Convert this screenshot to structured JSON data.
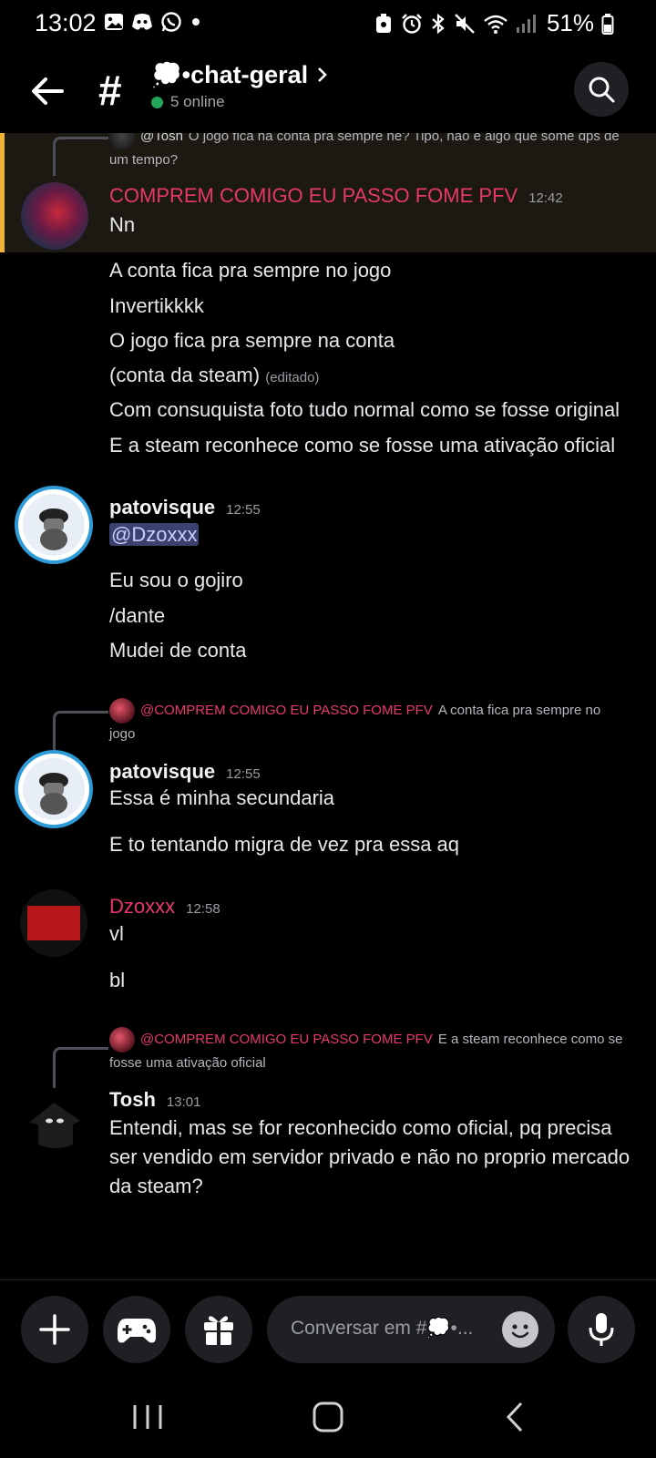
{
  "status_bar": {
    "time": "13:02",
    "battery": "51%"
  },
  "header": {
    "channel_name": "💭•chat-geral",
    "online": "5 online"
  },
  "messages": {
    "m0_reply": {
      "author": "@Tosh",
      "text": "O jogo fica na conta pra sempre né? Tipo, não é algo que some dps de um tempo?"
    },
    "m0": {
      "author": "COMPREM COMIGO EU PASSO FOME PFV",
      "time": "12:42",
      "lines": [
        "Nn"
      ]
    },
    "m1_lines": [
      "A conta fica pra sempre no jogo",
      "Invertikkkk",
      "O jogo fica pra sempre na conta",
      "(conta da steam)",
      "Com consuquista foto tudo normal como se fosse original",
      "E a steam reconhece como se fosse uma ativação oficial"
    ],
    "m1_edited": "(editado)",
    "m2": {
      "author": "patovisque",
      "time": "12:55",
      "mention": "@Dzoxxx",
      "lines": [
        "Eu sou o gojiro",
        "/dante",
        "Mudei de conta"
      ]
    },
    "m3_reply": {
      "author": "@COMPREM COMIGO EU PASSO FOME PFV",
      "text": "A conta fica pra sempre no jogo"
    },
    "m3": {
      "author": "patovisque",
      "time": "12:55",
      "lines": [
        "Essa é minha secundaria",
        "E to tentando migra de vez pra essa aq"
      ]
    },
    "m4": {
      "author": "Dzoxxx",
      "time": "12:58",
      "lines": [
        "vl",
        "bl"
      ]
    },
    "m5_reply": {
      "author": "@COMPREM COMIGO EU PASSO FOME PFV",
      "text": "E a steam reconhece como se fosse uma ativação oficial"
    },
    "m5": {
      "author": "Tosh",
      "time": "13:01",
      "text": "Entendi, mas se for reconhecido como oficial, pq precisa ser vendido em servidor privado e não no proprio mercado da steam?"
    }
  },
  "composer": {
    "placeholder": "Conversar em #💭•..."
  },
  "colors": {
    "accent_pink": "#e8386b",
    "online_green": "#23a55a",
    "highlight_bar": "#f0b232",
    "mention_bg": "#3c4270"
  },
  "icons": [
    "image-icon",
    "discord-icon",
    "whatsapp-icon",
    "alarm-icon",
    "bluetooth-icon",
    "mute-icon",
    "wifi-icon",
    "signal-icon",
    "battery-icon",
    "back-arrow-icon",
    "search-icon",
    "plus-icon",
    "gamepad-icon",
    "gift-icon",
    "emoji-icon",
    "mic-icon",
    "recents-icon",
    "home-icon",
    "back-icon"
  ]
}
